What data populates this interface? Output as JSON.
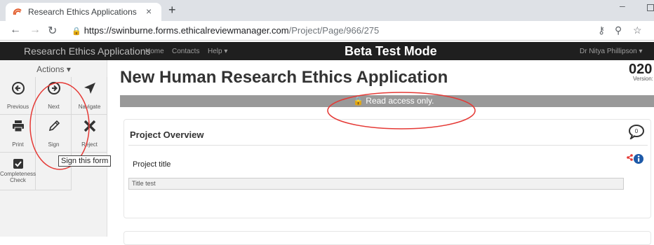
{
  "browser": {
    "tab_title": "Research Ethics Applications",
    "tab_close": "×",
    "new_tab": "+",
    "url_host": "https://swinburne.forms.ethicalreviewmanager.com",
    "url_path": "/Project/Page/966/275"
  },
  "appnav": {
    "title": "Research Ethics Applications",
    "links": [
      "Home",
      "Contacts",
      "Help ▾"
    ],
    "mode": "Beta Test Mode",
    "user": "Dr Nitya Phillipson ▾"
  },
  "sidebar": {
    "actions_label": "Actions ▾",
    "buttons": [
      {
        "label": "Previous",
        "icon": "previous-icon"
      },
      {
        "label": "Next",
        "icon": "next-icon"
      },
      {
        "label": "Navigate",
        "icon": "navigate-icon"
      },
      {
        "label": "Print",
        "icon": "print-icon"
      },
      {
        "label": "Sign",
        "icon": "pencil-icon"
      },
      {
        "label": "Reject",
        "icon": "x-icon"
      },
      {
        "label": "Completeness Check",
        "icon": "checkbox-icon"
      }
    ],
    "tooltip": "Sign this form"
  },
  "main": {
    "title": "New Human Research Ethics Application",
    "corner_number": "020",
    "corner_version": "Version:",
    "read_access": "Read access only.",
    "card": {
      "title": "Project Overview",
      "comment_count": "0",
      "field_label": "Project title",
      "field_value": "Title test"
    }
  },
  "colors": {
    "nav_bg": "#1f1f1f",
    "read_bar": "#999999",
    "annotation": "#e53935",
    "info_blue": "#1e5aa8"
  }
}
